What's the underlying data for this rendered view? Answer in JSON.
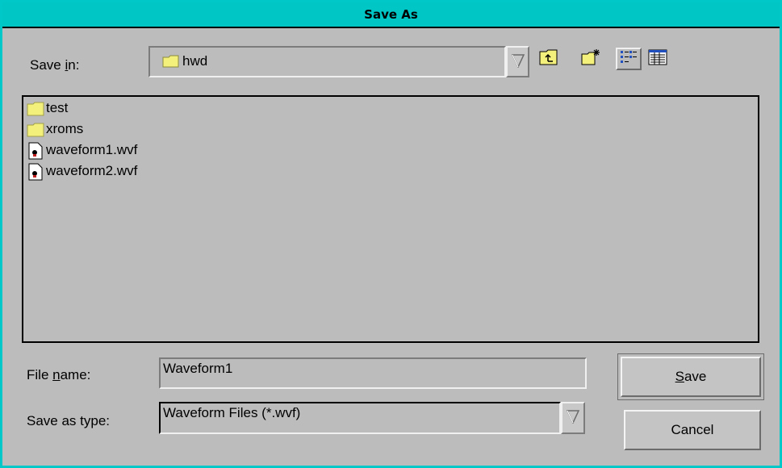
{
  "window": {
    "title": "Save As"
  },
  "save_in": {
    "label_pre": "Save ",
    "label_underline": "i",
    "label_post": "n:",
    "value": "hwd"
  },
  "toolbar": {
    "up_icon": "folder-up-icon",
    "new_folder_icon": "new-folder-icon",
    "list_view_icon": "list-view-icon",
    "details_view_icon": "details-view-icon"
  },
  "files": [
    {
      "name": "test",
      "type": "folder"
    },
    {
      "name": "xroms",
      "type": "folder"
    },
    {
      "name": "waveform1.wvf",
      "type": "file"
    },
    {
      "name": "waveform2.wvf",
      "type": "file"
    }
  ],
  "file_name": {
    "label_pre": "File ",
    "label_underline": "n",
    "label_post": "ame:",
    "value": "Waveform1"
  },
  "save_as_type": {
    "label": "Save as type:",
    "value": "Waveform Files (*.wvf)"
  },
  "buttons": {
    "save_underline": "S",
    "save_rest": "ave",
    "cancel": "Cancel"
  },
  "colors": {
    "title_bar": "#00c6c6",
    "dialog_bg": "#bcbcbc",
    "folder_yellow": "#f4f07c"
  }
}
